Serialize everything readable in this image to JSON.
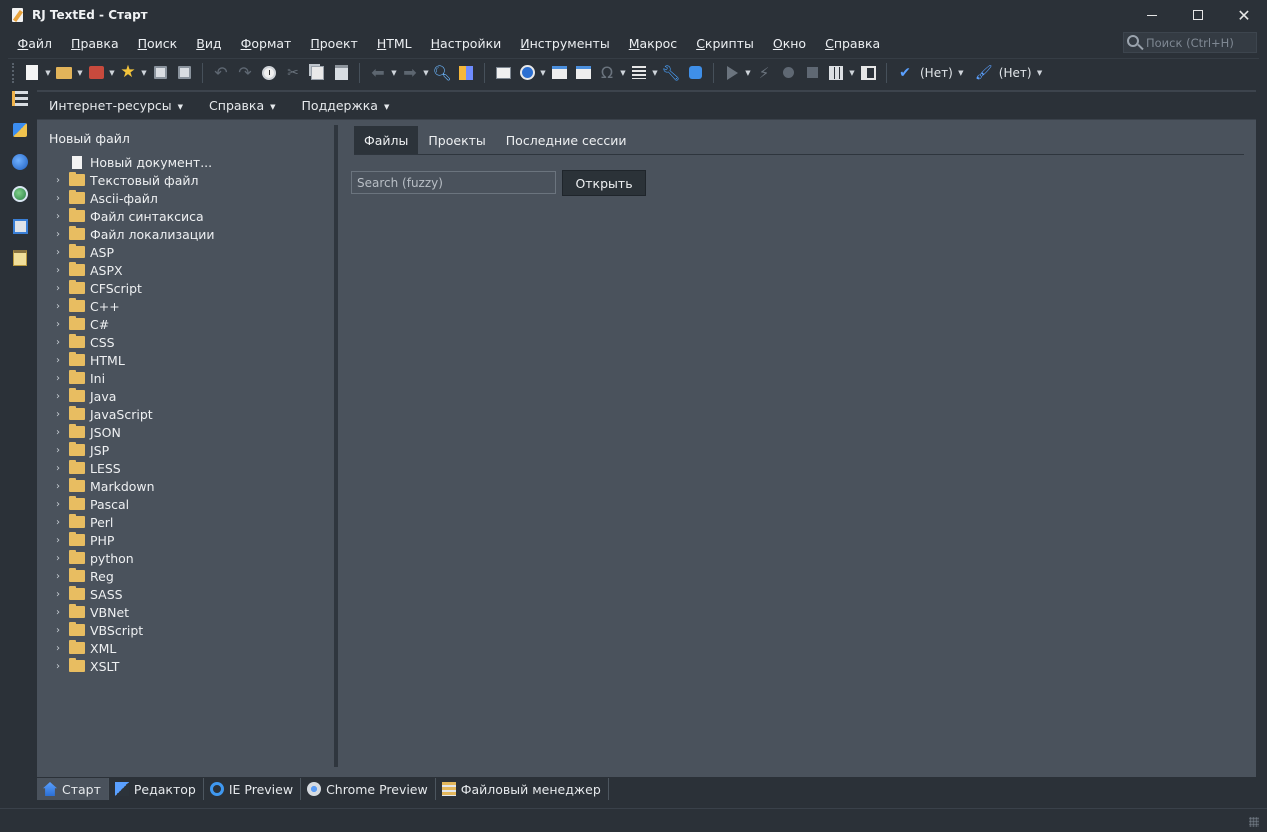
{
  "window": {
    "title": "RJ TextEd - Старт"
  },
  "menu": {
    "items": [
      {
        "label": "Файл",
        "ul": "Ф",
        "rest": "айл"
      },
      {
        "label": "Правка",
        "ul": "П",
        "rest": "равка"
      },
      {
        "label": "Поиск",
        "ul": "П",
        "rest": "оиск"
      },
      {
        "label": "Вид",
        "ul": "В",
        "rest": "ид"
      },
      {
        "label": "Формат",
        "ul": "Ф",
        "rest": "ормат"
      },
      {
        "label": "Проект",
        "ul": "П",
        "rest": "роект"
      },
      {
        "label": "HTML",
        "ul": "H",
        "rest": "TML"
      },
      {
        "label": "Настройки",
        "ul": "Н",
        "rest": "астройки"
      },
      {
        "label": "Инструменты",
        "ul": "И",
        "rest": "нструменты"
      },
      {
        "label": "Макрос",
        "ul": "М",
        "rest": "акрос"
      },
      {
        "label": "Скрипты",
        "ul": "С",
        "rest": "крипты"
      },
      {
        "label": "Окно",
        "ul": "О",
        "rest": "кно"
      },
      {
        "label": "Справка",
        "ul": "С",
        "rest": "правка"
      }
    ],
    "search_placeholder": "Поиск (Ctrl+H)"
  },
  "toolbar": {
    "spell_lang": "(Нет)",
    "highlighter": "(Нет)"
  },
  "subtoolbar": {
    "items": [
      "Интернет-ресурсы",
      "Справка",
      "Поддержка"
    ]
  },
  "tree": {
    "header": "Новый файл",
    "new_document": "Новый документ...",
    "folders": [
      "Текстовый файл",
      "Ascii-файл",
      "Файл синтаксиса",
      "Файл локализации",
      "ASP",
      "ASPX",
      "CFScript",
      "C++",
      "C#",
      "CSS",
      "HTML",
      "Ini",
      "Java",
      "JavaScript",
      "JSON",
      "JSP",
      "LESS",
      "Markdown",
      "Pascal",
      "Perl",
      "PHP",
      "python",
      "Reg",
      "SASS",
      "VBNet",
      "VBScript",
      "XML",
      "XSLT"
    ]
  },
  "start": {
    "tabs": [
      "Файлы",
      "Проекты",
      "Последние сессии"
    ],
    "active_tab": 0,
    "search_placeholder": "Search (fuzzy)",
    "search_value": "",
    "open_button": "Открыть"
  },
  "bottom_tabs": [
    "Старт",
    "Редактор",
    "IE Preview",
    "Chrome Preview",
    "Файловый менеджер"
  ],
  "colors": {
    "background": "#2b3138",
    "panel": "#4a525c",
    "accent": "#3b8df0",
    "folder": "#e8bd61"
  }
}
